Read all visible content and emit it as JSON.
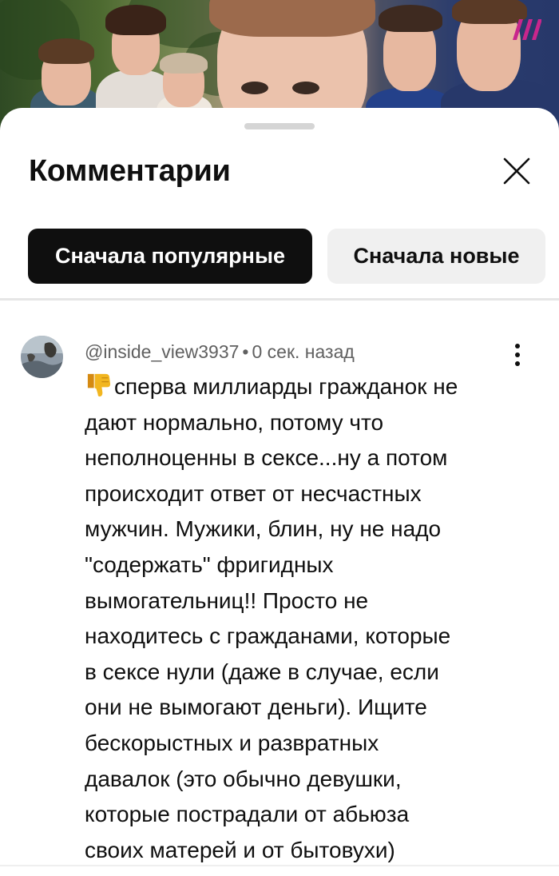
{
  "video": {
    "watermark_icon": "dozhd-logo-icon",
    "brand_color": "#c8268c"
  },
  "sheet": {
    "title": "Комментарии",
    "close_icon": "close-icon"
  },
  "sort_chips": {
    "popular_label": "Сначала популярные",
    "newest_label": "Сначала новые",
    "selected": "popular"
  },
  "comment": {
    "author": "@inside_view3937",
    "separator": "•",
    "time": "0 сек. назад",
    "emoji_icon": "thumbs-down-icon",
    "lines": [
      "сперва миллиарды гражданок не",
      "дают нормально, потому что",
      "неполноценны в сексе...ну а потом",
      "происходит ответ от несчастных",
      "мужчин. Мужики, блин, ну не надо",
      "\"содержать\" фригидных",
      "вымогательниц!! Просто не",
      "находитесь с гражданами, которые",
      "в сексе нули (даже в случае, если",
      "они не вымогают деньги). Ищите",
      "бескорыстных и развратных",
      "давалок (это обычно девушки,",
      "которые пострадали от абьюза",
      "своих матерей и от бытовухи)"
    ]
  },
  "colors": {
    "active_chip_bg": "#0f0f0f",
    "inactive_chip_bg": "#f0f0f0",
    "meta_text": "#606060"
  }
}
